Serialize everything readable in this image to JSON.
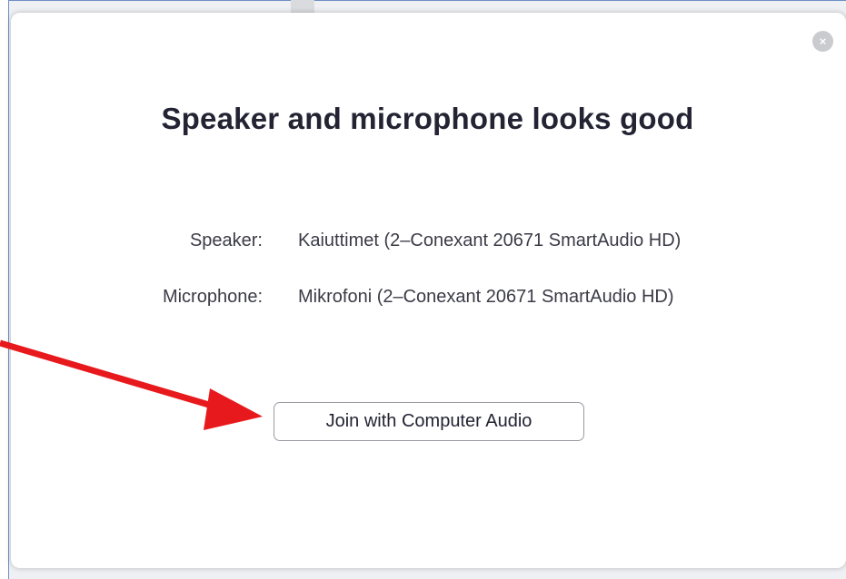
{
  "dialog": {
    "close_icon": "close-icon",
    "close_glyph": "×",
    "title": "Speaker and microphone looks good",
    "speaker": {
      "label": "Speaker:",
      "value": "Kaiuttimet (2–Conexant 20671 SmartAudio HD)"
    },
    "microphone": {
      "label": "Microphone:",
      "value": "Mikrofoni (2–Conexant 20671 SmartAudio HD)"
    },
    "join_button_label": "Join with Computer Audio"
  },
  "colors": {
    "annotation_arrow": "#e8191c",
    "window_border": "#6d8fc7",
    "title_text": "#232333"
  }
}
